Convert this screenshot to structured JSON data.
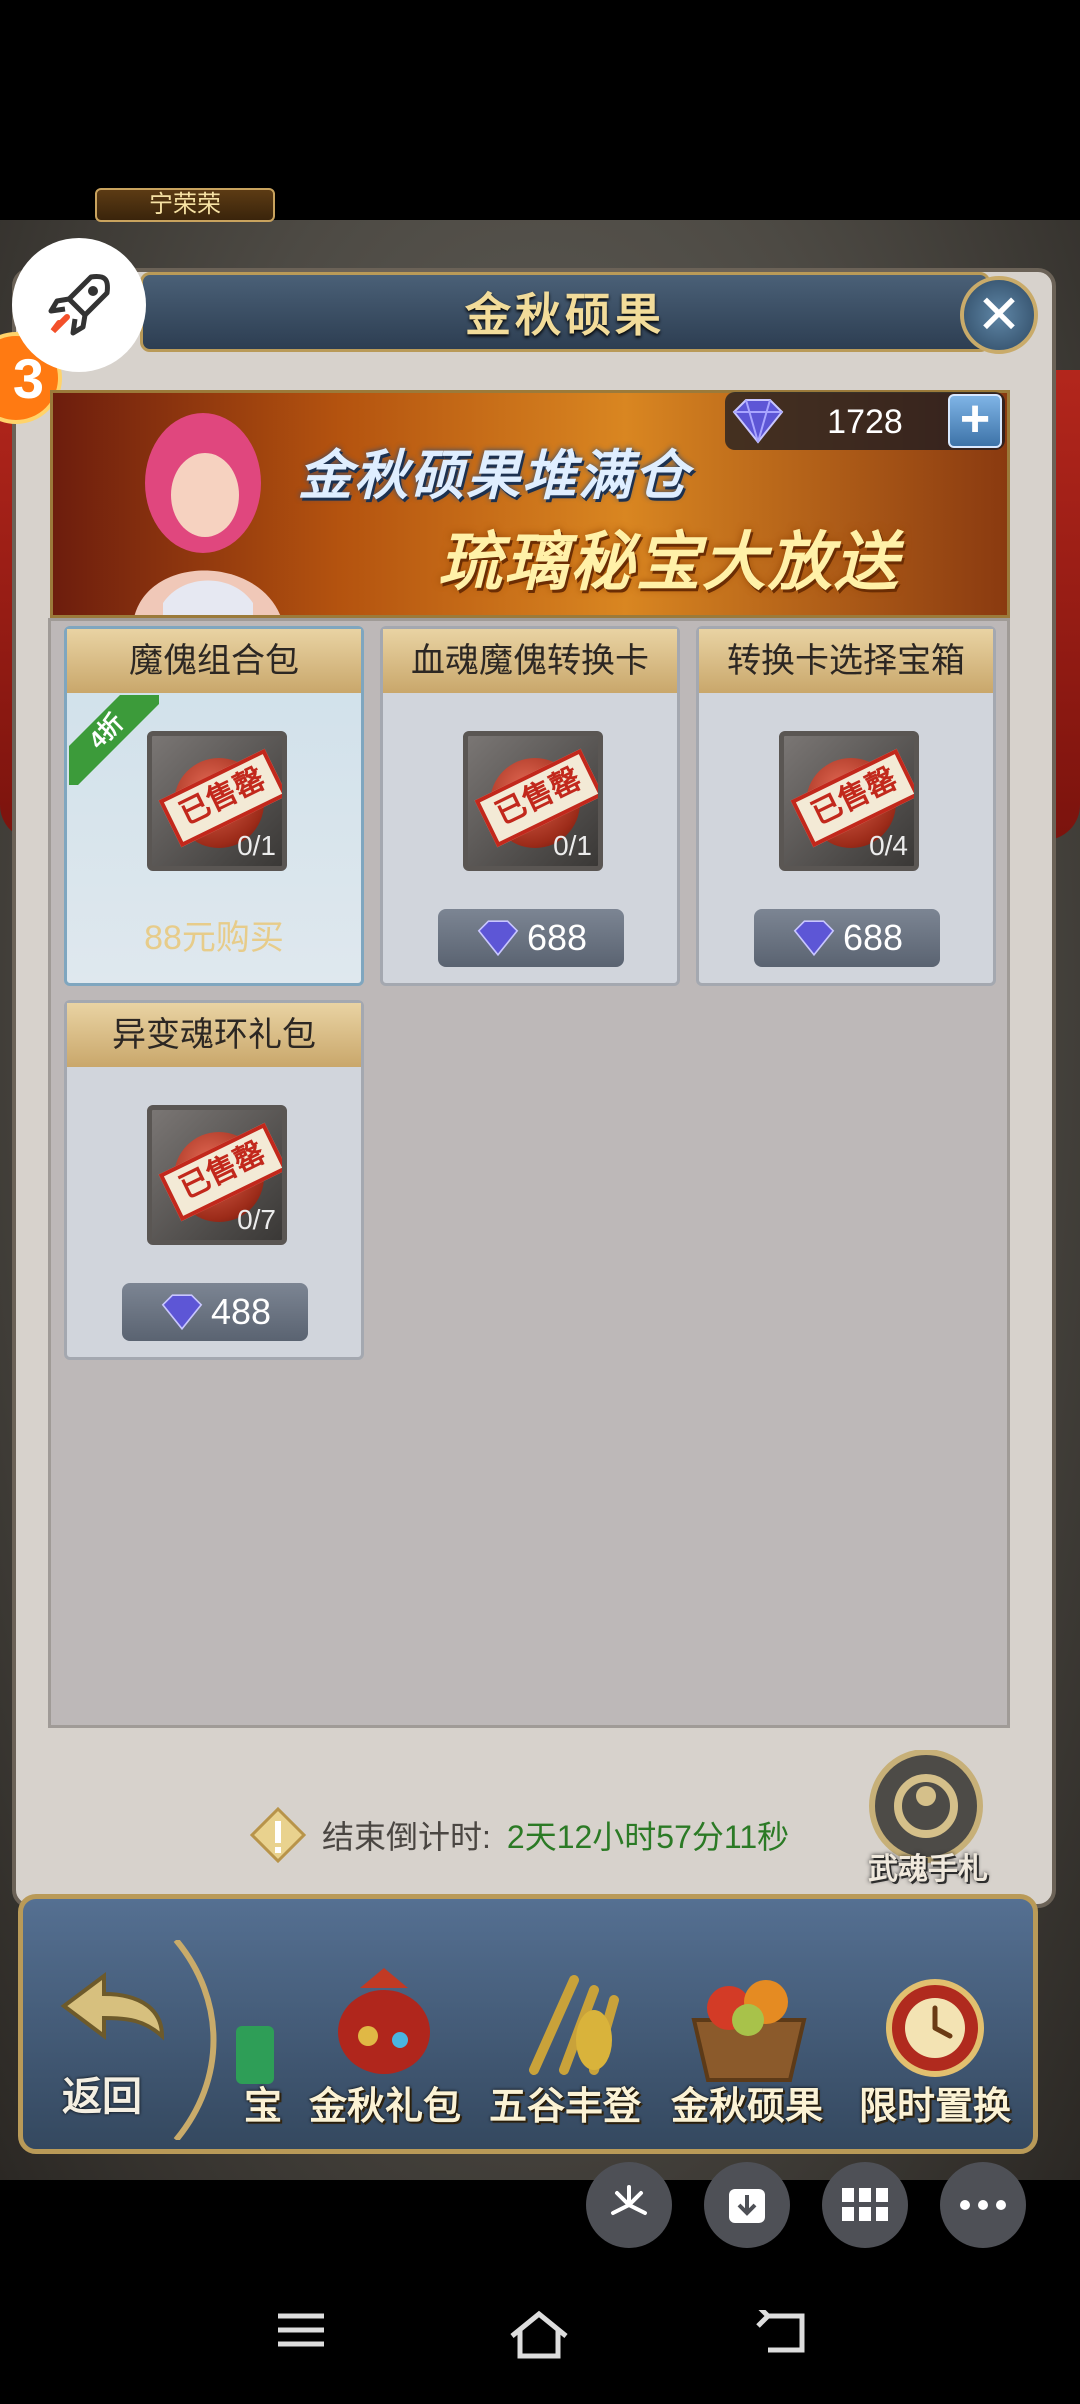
{
  "dialog": {
    "title": "金秋硕果",
    "close_icon": "close-icon"
  },
  "floating": {
    "rocket_icon": "rocket-icon",
    "side_badge": "3"
  },
  "banner": {
    "line1": "金秋硕果堆满仓",
    "line2": "琉璃秘宝大放送",
    "character_name": "宁荣荣"
  },
  "currency": {
    "icon": "diamond-icon",
    "value": "1728",
    "add_icon": "plus-icon"
  },
  "items": [
    {
      "title": "魔傀组合包",
      "stock": "0/1",
      "price_text": "88元购买",
      "discount": "4折",
      "stamp": "已售罄"
    },
    {
      "title": "血魂魔傀转换卡",
      "stock": "0/1",
      "price": "688",
      "stamp": "已售罄"
    },
    {
      "title": "转换卡选择宝箱",
      "stock": "0/4",
      "price": "688",
      "stamp": "已售罄"
    },
    {
      "title": "异变魂环礼包",
      "stock": "0/7",
      "price": "488",
      "stamp": "已售罄"
    }
  ],
  "countdown": {
    "label": "结束倒计时:",
    "value": "2天12小时57分11秒"
  },
  "wuhun_gift": "武魂手札",
  "nav": {
    "back": "返回",
    "tabs": [
      {
        "label": "宝"
      },
      {
        "label": "金秋礼包"
      },
      {
        "label": "五谷丰登"
      },
      {
        "label": "金秋硕果"
      },
      {
        "label": "限时置换"
      }
    ]
  },
  "overlay_buttons": [
    "pinwheel-icon",
    "download-icon",
    "grid-icon",
    "more-icon"
  ],
  "system_nav": [
    "menu-icon",
    "home-icon",
    "back-icon"
  ],
  "colors": {
    "countdown": "#2b7a25",
    "title": "#f2dc9a",
    "gold_border": "#b99a58"
  }
}
